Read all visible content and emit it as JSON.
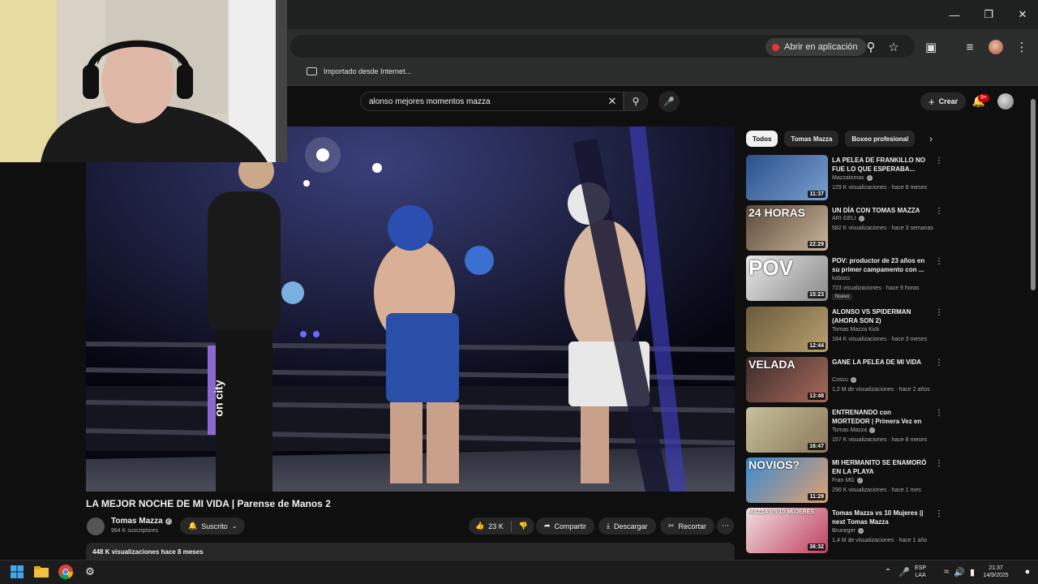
{
  "browser": {
    "open_in_app": "Abrir en aplicación",
    "bookmark": "Importado desde Internet..."
  },
  "youtube": {
    "search_query": "alonso mejores momentos mazza",
    "create_label": "Crear",
    "notifications": "9+"
  },
  "video": {
    "title": "LA MEJOR NOCHE DE MI VIDA | Parense de Manos 2",
    "channel": "Tomas Mazza",
    "subscribers": "964 K suscriptores",
    "subscribed_label": "Suscrito",
    "likes": "23 K",
    "share_label": "Compartir",
    "download_label": "Descargar",
    "clip_label": "Recortar",
    "views_date": "448 K visualizaciones  hace 8 meses",
    "ring_banner": "on city"
  },
  "chips": [
    "Todos",
    "Tomas Mazza",
    "Boxeo profesional"
  ],
  "recommendations": [
    {
      "title": "LA PELEA DE FRANKILLO NO FUE LO QUE ESPERABA...",
      "channel": "Mazzatomas",
      "verified": true,
      "meta": "129 K visualizaciones · hace 8 meses",
      "duration": "11:37",
      "colors": [
        "#2a4f8a",
        "#7aa0d0"
      ],
      "overlay": ""
    },
    {
      "title": "UN DÍA CON TOMAS MAZZA",
      "channel": "ARI GELI",
      "verified": true,
      "meta": "582 K visualizaciones · hace 3 semanas",
      "duration": "22:29",
      "colors": [
        "#5a4a3a",
        "#c9b59a"
      ],
      "overlay": "24 HORAS"
    },
    {
      "title": "POV: productor de 23 años en su primer campamento con ...",
      "channel": "koboss",
      "verified": false,
      "meta": "723 visualizaciones · hace 9 horas",
      "duration": "15:23",
      "colors": [
        "#e8e8e8",
        "#8a8a8a"
      ],
      "overlay": "POV",
      "new": "Nuevo"
    },
    {
      "title": "ALONSO VS SPIDERMAN (AHORA SON 2)",
      "channel": "Tomas Mazza Kick",
      "verified": false,
      "meta": "184 K visualizaciones · hace 3 meses",
      "duration": "12:44",
      "colors": [
        "#6a5a3a",
        "#b8a070"
      ],
      "overlay": ""
    },
    {
      "title": "GANE LA PELEA DE MI VIDA",
      "channel": "Coscu",
      "verified": true,
      "meta": "1,2 M de visualizaciones · hace 2 años",
      "duration": "13:48",
      "colors": [
        "#3a2a2a",
        "#a86a5a"
      ],
      "overlay": "VELADA"
    },
    {
      "title": "ENTRENANDO con MORTEDOR | Primera Vez en El Gym",
      "channel": "Tomas Mazza",
      "verified": true,
      "meta": "157 K visualizaciones · hace 8 meses",
      "duration": "16:47",
      "colors": [
        "#c9c09a",
        "#8a7a5a"
      ],
      "overlay": ""
    },
    {
      "title": "MI HERMANITO SE ENAMORÓ EN LA PLAYA",
      "channel": "Fran MG",
      "verified": true,
      "meta": "290 K visualizaciones · hace 1 mes",
      "duration": "11:29",
      "colors": [
        "#3a8ad0",
        "#e0a070"
      ],
      "overlay": "NOVIOS?"
    },
    {
      "title": "Tomas Mazza vs 10 Mujeres || next Tomas Mazza",
      "channel": "Bruneger",
      "verified": true,
      "meta": "1,4 M de visualizaciones · hace 1 año",
      "duration": "36:32",
      "colors": [
        "#f0e0e0",
        "#c04060"
      ],
      "overlay": "MAZZA VS 10 MUJERES"
    }
  ],
  "taskbar": {
    "lang": "ESP",
    "region": "LAA",
    "time": "21:37",
    "date": "14/9/2025"
  },
  "colors": {
    "background": "#0f0f0f",
    "chip_active": "#f1f1f1",
    "accent_red": "#cc0000"
  }
}
